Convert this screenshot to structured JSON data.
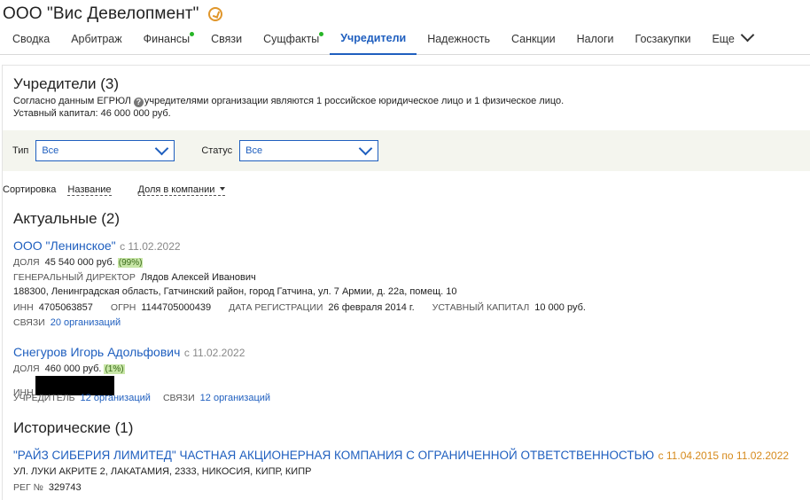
{
  "header": {
    "company_title": "ООО \"Вис Девелопмент\""
  },
  "tabs": [
    {
      "label": "Сводка",
      "dot": false,
      "active": false
    },
    {
      "label": "Арбитраж",
      "dot": false,
      "active": false
    },
    {
      "label": "Финансы",
      "dot": true,
      "active": false
    },
    {
      "label": "Связи",
      "dot": false,
      "active": false
    },
    {
      "label": "Сущфакты",
      "dot": true,
      "active": false
    },
    {
      "label": "Учредители",
      "dot": false,
      "active": true
    },
    {
      "label": "Надежность",
      "dot": false,
      "active": false
    },
    {
      "label": "Санкции",
      "dot": false,
      "active": false
    },
    {
      "label": "Налоги",
      "dot": false,
      "active": false
    },
    {
      "label": "Госзакупки",
      "dot": false,
      "active": false
    },
    {
      "label": "Еще",
      "dot": false,
      "active": false
    }
  ],
  "founders": {
    "title": "Учредители (3)",
    "info_line_1a": "Согласно данным ЕГРЮЛ",
    "info_line_1b": "учредителями организации являются 1 российское юридическое лицо и 1 физическое лицо.",
    "info_line_2": "Уставный капитал: 46 000 000 руб."
  },
  "filters": {
    "type_label": "Тип",
    "type_value": "Все",
    "status_label": "Статус",
    "status_value": "Все"
  },
  "sort": {
    "label": "Сортировка",
    "by_name": "Название",
    "by_share": "Доля в компании"
  },
  "current": {
    "title": "Актуальные (2)",
    "org": {
      "name": "ООО \"Ленинское\"",
      "since": "с 11.02.2022",
      "share_label": "ДОЛЯ",
      "share_value": "45 540 000 руб.",
      "share_pct": "(99%)",
      "director_label": "ГЕНЕРАЛЬНЫЙ ДИРЕКТОР",
      "director_value": "Лядов Алексей Иванович",
      "address": "188300, Ленинградская область, Гатчинский район, город Гатчина, ул. 7 Армии, д. 22а, помещ. 10",
      "inn_label": "ИНН",
      "inn_value": "4705063857",
      "ogrn_label": "ОГРН",
      "ogrn_value": "1144705000439",
      "reg_label": "ДАТА РЕГИСТРАЦИИ",
      "reg_value": "26 февраля 2014 г.",
      "capital_label": "УСТАВНЫЙ КАПИТАЛ",
      "capital_value": "10 000 руб.",
      "links_label": "СВЯЗИ",
      "links_value": "20 организаций"
    },
    "person": {
      "name": "Снегуров Игорь Адольфович",
      "since": "с 11.02.2022",
      "share_label": "ДОЛЯ",
      "share_value": "460 000 руб.",
      "share_pct": "(1%)",
      "inn_label": "ИНН",
      "founder_label": "УЧРЕДИТЕЛЬ",
      "founder_value": "12 организаций",
      "links_label": "СВЯЗИ",
      "links_value": "12 организаций"
    }
  },
  "historical": {
    "title": "Исторические (1)",
    "org": {
      "name": "\"РАЙЗ СИБЕРИЯ ЛИМИТЕД\" ЧАСТНАЯ АКЦИОНЕРНАЯ КОМПАНИЯ С ОГРАНИЧЕННОЙ ОТВЕТСТВЕННОСТЬЮ",
      "period": "с 11.04.2015 по 11.02.2022",
      "address": "УЛ. ЛУКИ АКРИТЕ 2, ЛАКАТАМИЯ, 2333, НИКОСИЯ, КИПР, КИПР",
      "reg_label": "РЕГ №",
      "reg_value": "329743"
    }
  },
  "colors": {
    "accent": "#1f5fbf",
    "dot": "#26b526",
    "historical_period": "#d68a1c",
    "share_badge": "#c8e6a7"
  }
}
